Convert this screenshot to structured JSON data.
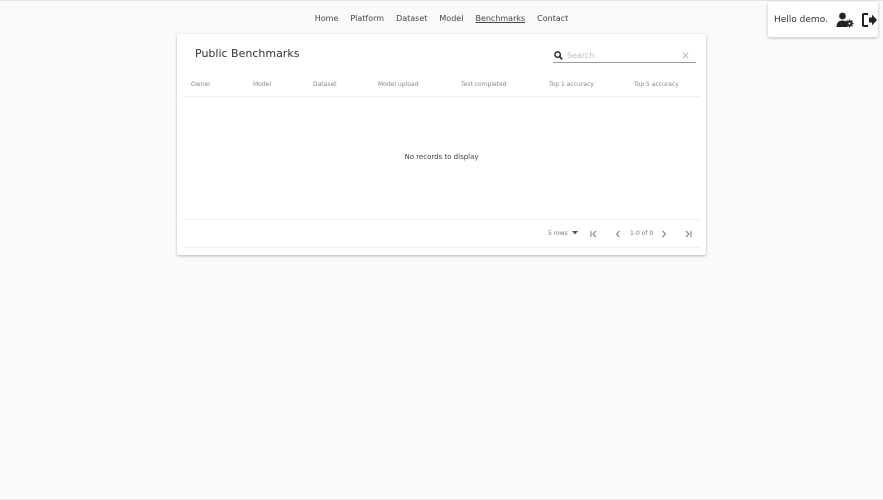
{
  "nav": {
    "items": [
      {
        "label": "Home"
      },
      {
        "label": "Platform"
      },
      {
        "label": "Dataset"
      },
      {
        "label": "Model"
      },
      {
        "label": "Benchmarks",
        "active": true
      },
      {
        "label": "Contact"
      }
    ]
  },
  "user": {
    "greeting": "Hello demo.",
    "icons": [
      "user-settings-icon",
      "sign-out-icon"
    ]
  },
  "card": {
    "title": "Public Benchmarks",
    "search": {
      "placeholder": "Search",
      "value": ""
    },
    "columns": [
      "Owner",
      "Model",
      "Dataset",
      "Model upload",
      "Test completed",
      "Top 1 accuracy",
      "Top 5 accuracy"
    ],
    "empty_message": "No records to display",
    "pagination": {
      "rows_label": "5 rows",
      "range_label": "1-0 of 0"
    }
  },
  "colors": {
    "background": "#fafafa",
    "card": "#ffffff",
    "text": "#333333",
    "muted": "#888888"
  }
}
